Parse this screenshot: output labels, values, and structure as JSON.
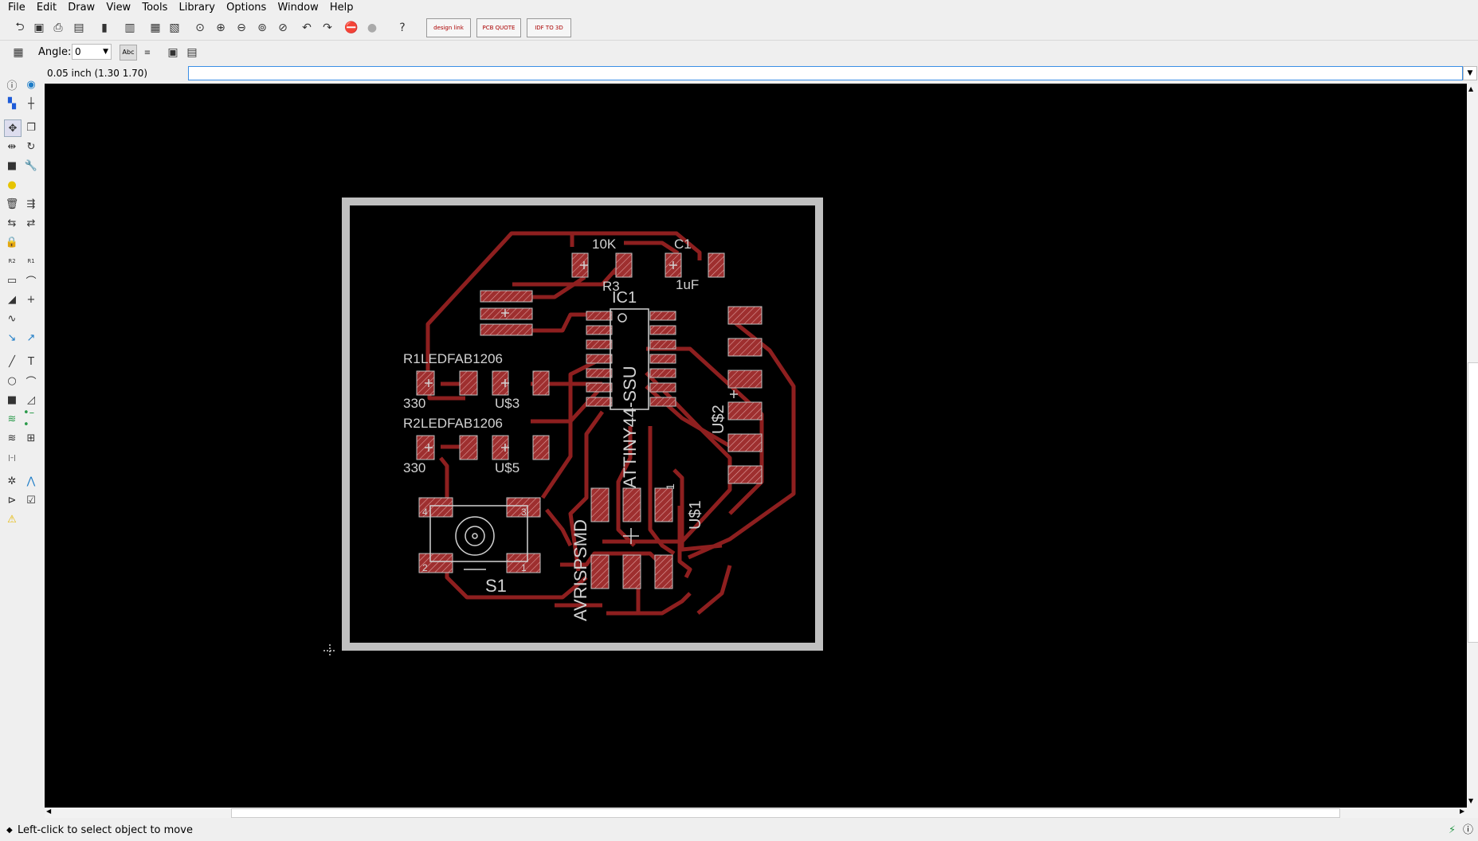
{
  "menu": [
    "File",
    "Edit",
    "Draw",
    "View",
    "Tools",
    "Library",
    "Options",
    "Window",
    "Help"
  ],
  "toolbar": {
    "icons": [
      "open-icon",
      "save-icon",
      "print-icon",
      "cam-icon",
      "script-icon",
      "layers-icon",
      "sch-brd-icon",
      "board-icon",
      "zoom-fit-icon",
      "zoom-in-icon",
      "zoom-out-icon",
      "zoom-select-icon",
      "zoom-last-icon",
      "undo-icon",
      "redo-icon",
      "stop-icon",
      "go-icon",
      "help-icon"
    ],
    "ext1": "design link",
    "ext2": "PCB QUOTE",
    "ext3": "IDF TO 3D"
  },
  "params": {
    "angle_label": "Angle:",
    "angle_value": "0",
    "mirror_text": "Abc"
  },
  "cmd": {
    "coords": "0.05 inch (1.30 1.70)",
    "input_value": ""
  },
  "status": {
    "message": "Left-click to select object to move"
  },
  "board": {
    "labels": {
      "r3_value": "10K",
      "r3_name": "R3",
      "c1_name": "C1",
      "c1_value": "1uF",
      "ic1_name": "IC1",
      "ic1_value": "ATTINY44-SSU",
      "r1_name": "R1",
      "led1": "LEDFAB1206",
      "r1_value": "330",
      "u3": "U$3",
      "r2_name": "R2",
      "led2": "LEDFAB1206",
      "r2_value": "330",
      "u5": "U$5",
      "s1": "S1",
      "s1_p1": "1",
      "s1_p2": "2",
      "s1_p3": "3",
      "s1_p4": "4",
      "u2": "U$2",
      "u1": "U$1",
      "avr": "AVRISPSMD",
      "u1_pin": "1"
    }
  },
  "colors": {
    "trace": "#8e1f1f",
    "pad": "#b23a3a",
    "outline": "#c0c0c0",
    "silk": "#d2d2d2",
    "bg": "#000000"
  }
}
